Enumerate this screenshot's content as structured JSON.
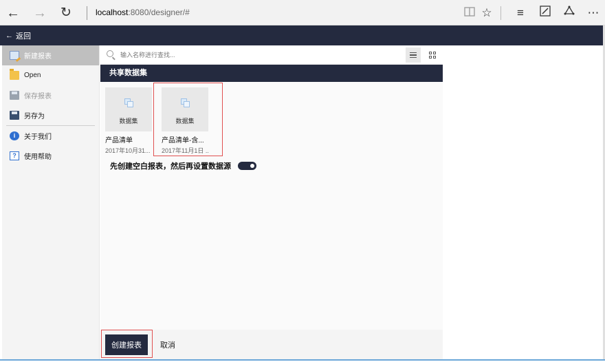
{
  "browser": {
    "url_host": "localhost",
    "url_rest": ":8080/designer/#",
    "icons": [
      "back-arrow-icon",
      "forward-arrow-icon",
      "refresh-icon",
      "reading-view-icon",
      "favorite-star-icon",
      "hub-icon",
      "web-note-icon",
      "share-icon",
      "more-icon"
    ]
  },
  "appbar": {
    "back_label": "返回"
  },
  "sidebar": {
    "items": [
      {
        "label": "新建报表",
        "icon": "new-report-icon",
        "state": "active"
      },
      {
        "label": "Open",
        "icon": "folder-icon",
        "state": "normal"
      },
      {
        "label": "保存报表",
        "icon": "save-icon",
        "state": "disabled"
      },
      {
        "label": "另存为",
        "icon": "save-as-icon",
        "state": "normal"
      },
      {
        "label": "关于我们",
        "icon": "info-icon",
        "state": "normal"
      },
      {
        "label": "使用帮助",
        "icon": "help-icon",
        "state": "normal"
      }
    ]
  },
  "search": {
    "placeholder": "输入名称进行查找..."
  },
  "section": {
    "title": "共享数据集"
  },
  "datasets": [
    {
      "thumb_label": "数据集",
      "name": "产品清单",
      "date": "2017年10月31...",
      "selected": false
    },
    {
      "thumb_label": "数据集",
      "name": "产品清单-含...",
      "date": "2017年11月1日 ...",
      "selected": true
    }
  ],
  "toggle": {
    "label": "先创建空白报表，然后再设置数据源",
    "on": true
  },
  "actions": {
    "create_label": "创建报表",
    "cancel_label": "取消"
  },
  "colors": {
    "dark_navy": "#242a3f",
    "highlight_red": "#e05050",
    "active_item": "#bfbfbf"
  }
}
